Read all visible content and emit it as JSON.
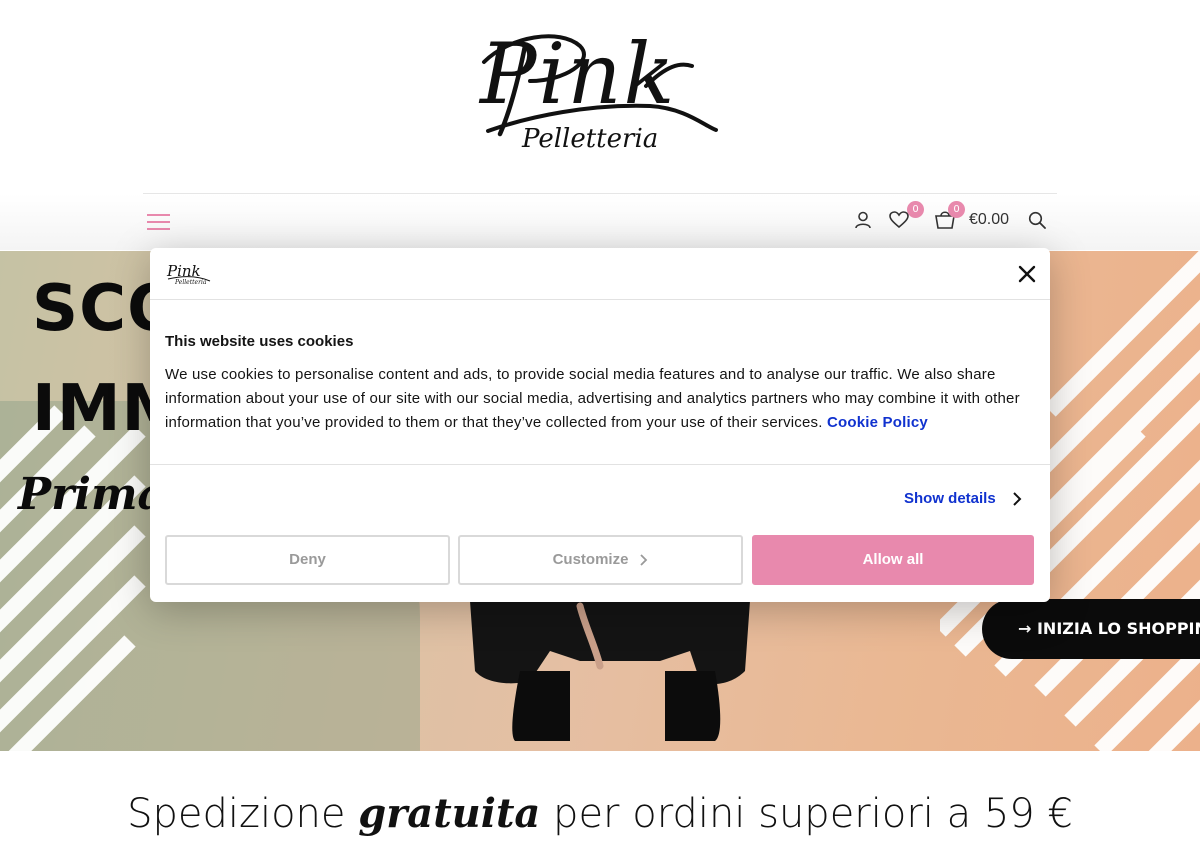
{
  "brand": {
    "logo_main": "Pink",
    "logo_sub": "Pelletteria"
  },
  "nav": {
    "menu_icon": "hamburger-icon",
    "account_icon": "user-icon",
    "wishlist_icon": "heart-icon",
    "wishlist_count": "0",
    "cart_icon": "shopping-bag-icon",
    "cart_count": "0",
    "cart_total": "€0.00",
    "search_icon": "search-icon"
  },
  "hero": {
    "title_line1": "SCO",
    "title_line2": "IMM",
    "script_line": "Primav",
    "cta_label": "→ INIZIA LO SHOPPING"
  },
  "shipping": {
    "before": "Spedizione ",
    "emphasis": "gratuita",
    "after": " per ordini superiori a 59 €"
  },
  "cookie_dialog": {
    "close_icon": "close-icon",
    "title": "This website uses cookies",
    "body": "We use cookies to personalise content and ads, to provide social media features and to analyse our traffic. We also share information about your use of our site with our social media, advertising and analytics partners who may combine it with other information that you’ve provided to them or that they’ve collected from your use of their services.",
    "policy_link": "Cookie Policy",
    "show_details": "Show details",
    "buttons": {
      "deny": "Deny",
      "customize": "Customize",
      "allow_all": "Allow all"
    }
  },
  "colors": {
    "accent_pink": "#e889ad",
    "link_blue": "#1032cf",
    "text_dark": "#141414"
  }
}
